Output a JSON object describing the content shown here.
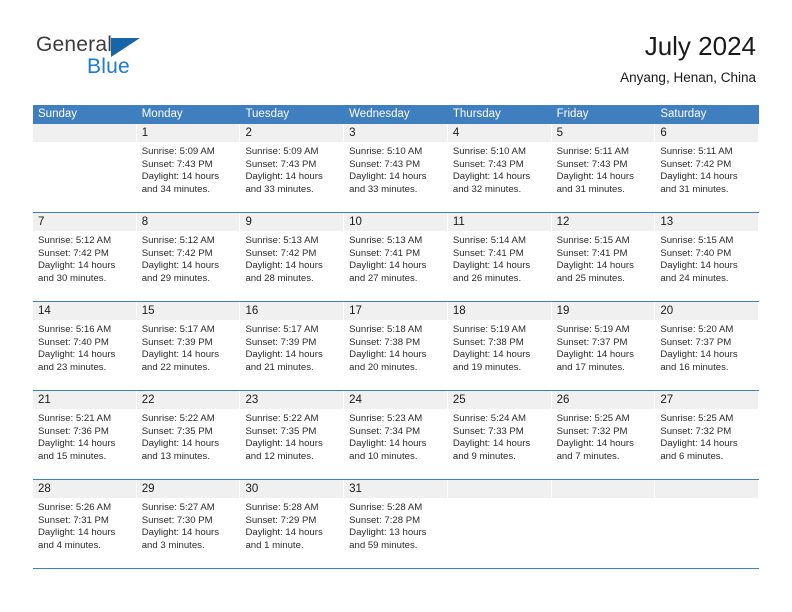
{
  "brand": {
    "name_top": "General",
    "name_bottom": "Blue",
    "triangle_icon": "triangle-icon"
  },
  "header": {
    "title": "July 2024",
    "subtitle": "Anyang, Henan, China"
  },
  "colors": {
    "header_blue": "#3f7fbf",
    "brand_blue": "#1b7ad1",
    "day_band_gray": "#f0f0f0",
    "text": "#1a1a1a"
  },
  "weekdays": [
    "Sunday",
    "Monday",
    "Tuesday",
    "Wednesday",
    "Thursday",
    "Friday",
    "Saturday"
  ],
  "weeks": [
    [
      {
        "day": "",
        "lines": []
      },
      {
        "day": "1",
        "lines": [
          "Sunrise: 5:09 AM",
          "Sunset: 7:43 PM",
          "Daylight: 14 hours",
          "and 34 minutes."
        ]
      },
      {
        "day": "2",
        "lines": [
          "Sunrise: 5:09 AM",
          "Sunset: 7:43 PM",
          "Daylight: 14 hours",
          "and 33 minutes."
        ]
      },
      {
        "day": "3",
        "lines": [
          "Sunrise: 5:10 AM",
          "Sunset: 7:43 PM",
          "Daylight: 14 hours",
          "and 33 minutes."
        ]
      },
      {
        "day": "4",
        "lines": [
          "Sunrise: 5:10 AM",
          "Sunset: 7:43 PM",
          "Daylight: 14 hours",
          "and 32 minutes."
        ]
      },
      {
        "day": "5",
        "lines": [
          "Sunrise: 5:11 AM",
          "Sunset: 7:43 PM",
          "Daylight: 14 hours",
          "and 31 minutes."
        ]
      },
      {
        "day": "6",
        "lines": [
          "Sunrise: 5:11 AM",
          "Sunset: 7:42 PM",
          "Daylight: 14 hours",
          "and 31 minutes."
        ]
      }
    ],
    [
      {
        "day": "7",
        "lines": [
          "Sunrise: 5:12 AM",
          "Sunset: 7:42 PM",
          "Daylight: 14 hours",
          "and 30 minutes."
        ]
      },
      {
        "day": "8",
        "lines": [
          "Sunrise: 5:12 AM",
          "Sunset: 7:42 PM",
          "Daylight: 14 hours",
          "and 29 minutes."
        ]
      },
      {
        "day": "9",
        "lines": [
          "Sunrise: 5:13 AM",
          "Sunset: 7:42 PM",
          "Daylight: 14 hours",
          "and 28 minutes."
        ]
      },
      {
        "day": "10",
        "lines": [
          "Sunrise: 5:13 AM",
          "Sunset: 7:41 PM",
          "Daylight: 14 hours",
          "and 27 minutes."
        ]
      },
      {
        "day": "11",
        "lines": [
          "Sunrise: 5:14 AM",
          "Sunset: 7:41 PM",
          "Daylight: 14 hours",
          "and 26 minutes."
        ]
      },
      {
        "day": "12",
        "lines": [
          "Sunrise: 5:15 AM",
          "Sunset: 7:41 PM",
          "Daylight: 14 hours",
          "and 25 minutes."
        ]
      },
      {
        "day": "13",
        "lines": [
          "Sunrise: 5:15 AM",
          "Sunset: 7:40 PM",
          "Daylight: 14 hours",
          "and 24 minutes."
        ]
      }
    ],
    [
      {
        "day": "14",
        "lines": [
          "Sunrise: 5:16 AM",
          "Sunset: 7:40 PM",
          "Daylight: 14 hours",
          "and 23 minutes."
        ]
      },
      {
        "day": "15",
        "lines": [
          "Sunrise: 5:17 AM",
          "Sunset: 7:39 PM",
          "Daylight: 14 hours",
          "and 22 minutes."
        ]
      },
      {
        "day": "16",
        "lines": [
          "Sunrise: 5:17 AM",
          "Sunset: 7:39 PM",
          "Daylight: 14 hours",
          "and 21 minutes."
        ]
      },
      {
        "day": "17",
        "lines": [
          "Sunrise: 5:18 AM",
          "Sunset: 7:38 PM",
          "Daylight: 14 hours",
          "and 20 minutes."
        ]
      },
      {
        "day": "18",
        "lines": [
          "Sunrise: 5:19 AM",
          "Sunset: 7:38 PM",
          "Daylight: 14 hours",
          "and 19 minutes."
        ]
      },
      {
        "day": "19",
        "lines": [
          "Sunrise: 5:19 AM",
          "Sunset: 7:37 PM",
          "Daylight: 14 hours",
          "and 17 minutes."
        ]
      },
      {
        "day": "20",
        "lines": [
          "Sunrise: 5:20 AM",
          "Sunset: 7:37 PM",
          "Daylight: 14 hours",
          "and 16 minutes."
        ]
      }
    ],
    [
      {
        "day": "21",
        "lines": [
          "Sunrise: 5:21 AM",
          "Sunset: 7:36 PM",
          "Daylight: 14 hours",
          "and 15 minutes."
        ]
      },
      {
        "day": "22",
        "lines": [
          "Sunrise: 5:22 AM",
          "Sunset: 7:35 PM",
          "Daylight: 14 hours",
          "and 13 minutes."
        ]
      },
      {
        "day": "23",
        "lines": [
          "Sunrise: 5:22 AM",
          "Sunset: 7:35 PM",
          "Daylight: 14 hours",
          "and 12 minutes."
        ]
      },
      {
        "day": "24",
        "lines": [
          "Sunrise: 5:23 AM",
          "Sunset: 7:34 PM",
          "Daylight: 14 hours",
          "and 10 minutes."
        ]
      },
      {
        "day": "25",
        "lines": [
          "Sunrise: 5:24 AM",
          "Sunset: 7:33 PM",
          "Daylight: 14 hours",
          "and 9 minutes."
        ]
      },
      {
        "day": "26",
        "lines": [
          "Sunrise: 5:25 AM",
          "Sunset: 7:32 PM",
          "Daylight: 14 hours",
          "and 7 minutes."
        ]
      },
      {
        "day": "27",
        "lines": [
          "Sunrise: 5:25 AM",
          "Sunset: 7:32 PM",
          "Daylight: 14 hours",
          "and 6 minutes."
        ]
      }
    ],
    [
      {
        "day": "28",
        "lines": [
          "Sunrise: 5:26 AM",
          "Sunset: 7:31 PM",
          "Daylight: 14 hours",
          "and 4 minutes."
        ]
      },
      {
        "day": "29",
        "lines": [
          "Sunrise: 5:27 AM",
          "Sunset: 7:30 PM",
          "Daylight: 14 hours",
          "and 3 minutes."
        ]
      },
      {
        "day": "30",
        "lines": [
          "Sunrise: 5:28 AM",
          "Sunset: 7:29 PM",
          "Daylight: 14 hours",
          "and 1 minute."
        ]
      },
      {
        "day": "31",
        "lines": [
          "Sunrise: 5:28 AM",
          "Sunset: 7:28 PM",
          "Daylight: 13 hours",
          "and 59 minutes."
        ]
      },
      {
        "day": "",
        "lines": []
      },
      {
        "day": "",
        "lines": []
      },
      {
        "day": "",
        "lines": []
      }
    ]
  ]
}
